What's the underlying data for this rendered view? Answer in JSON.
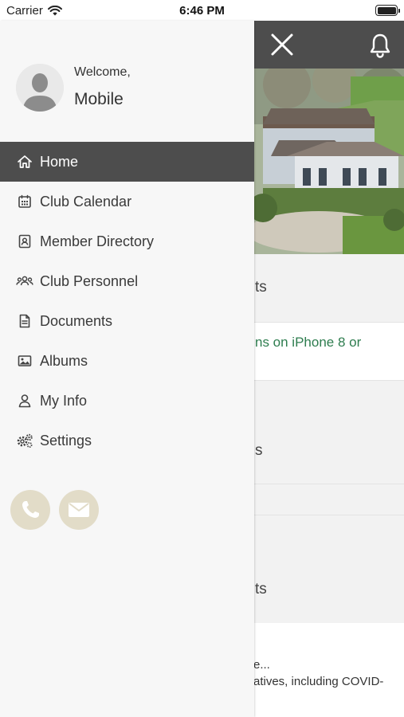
{
  "status_bar": {
    "carrier": "Carrier",
    "time": "6:46 PM"
  },
  "background": {
    "section_title_1": "ts",
    "news_link": "ns on iPhone 8 or",
    "section_title_2": "s",
    "section_title_3": "ts",
    "post_title": "e...",
    "post_excerpt": "atives, including COVID-"
  },
  "drawer": {
    "welcome_label": "Welcome,",
    "username": "Mobile",
    "menu_items": [
      {
        "label": "Home",
        "icon": "home-icon",
        "active": true
      },
      {
        "label": "Club Calendar",
        "icon": "calendar-icon",
        "active": false
      },
      {
        "label": "Member Directory",
        "icon": "contact-card-icon",
        "active": false
      },
      {
        "label": "Club Personnel",
        "icon": "group-icon",
        "active": false
      },
      {
        "label": "Documents",
        "icon": "document-icon",
        "active": false
      },
      {
        "label": "Albums",
        "icon": "image-icon",
        "active": false
      },
      {
        "label": "My Info",
        "icon": "user-icon",
        "active": false
      },
      {
        "label": "Settings",
        "icon": "gears-icon",
        "active": false
      }
    ],
    "contact_buttons": [
      {
        "icon": "phone-icon"
      },
      {
        "icon": "envelope-icon"
      }
    ]
  },
  "colors": {
    "header_bg": "#4d4d4d",
    "active_item_bg": "#4d4d4d",
    "drawer_bg": "#f7f7f7",
    "contact_button_bg": "#e2dcc8",
    "link_green": "#2e7d4f"
  }
}
